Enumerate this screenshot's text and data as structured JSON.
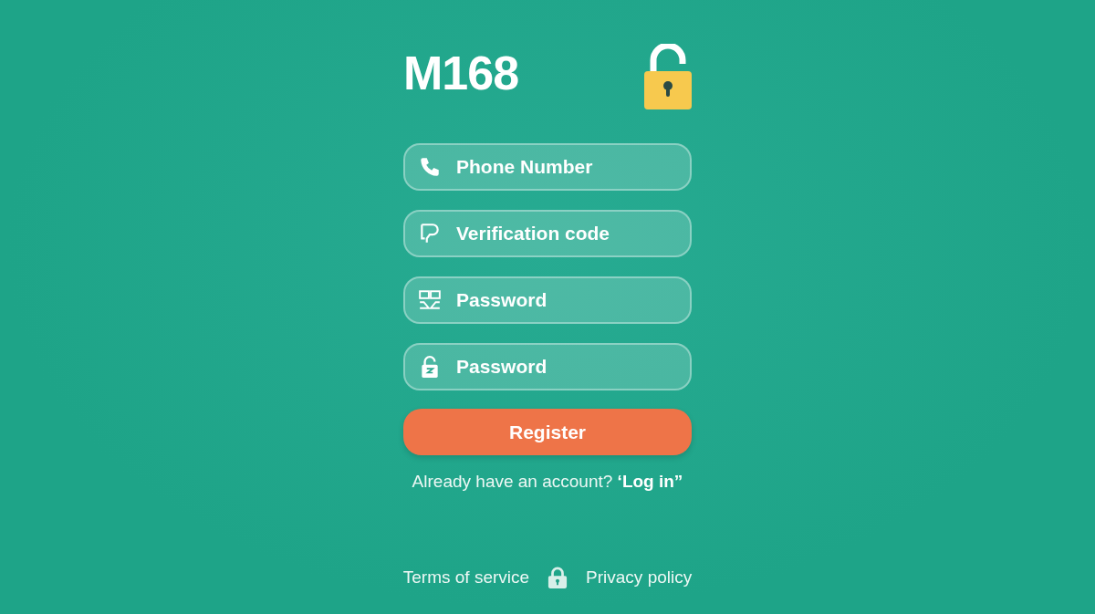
{
  "logo": "M168",
  "fields": [
    {
      "kind": "phone",
      "placeholder": "Phone Number"
    },
    {
      "kind": "code",
      "placeholder": "Verification code"
    },
    {
      "kind": "grid",
      "placeholder": "Password"
    },
    {
      "kind": "lock",
      "placeholder": "Password"
    }
  ],
  "register_button": "Register",
  "login_prompt": {
    "text": "Already have an account?",
    "link": "‘Log in”"
  },
  "footer": {
    "terms": "Terms of service",
    "privacy": "Privacy policy"
  }
}
